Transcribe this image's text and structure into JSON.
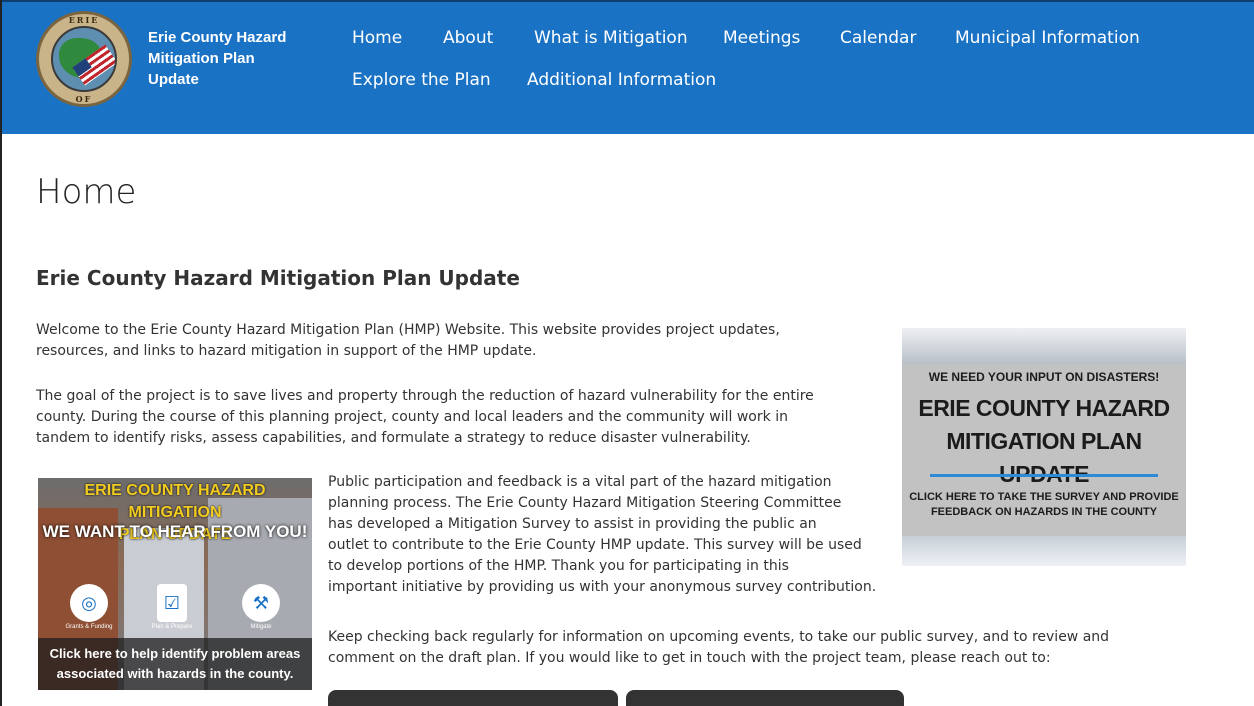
{
  "header": {
    "site_title": "Erie County Hazard Mitigation Plan Update",
    "seal_text_top": "ERIE",
    "seal_text_bottom": "OF",
    "background_color": "#1a72c4"
  },
  "nav": {
    "items": [
      {
        "label": "Home"
      },
      {
        "label": "About"
      },
      {
        "label": "What is Mitigation"
      },
      {
        "label": "Meetings"
      },
      {
        "label": "Calendar"
      },
      {
        "label": "Municipal Information"
      },
      {
        "label": "Explore the Plan"
      },
      {
        "label": "Additional Information"
      }
    ]
  },
  "main": {
    "page_title": "Home",
    "subtitle": "Erie County Hazard Mitigation Plan Update",
    "para1_line1": "Welcome to the Erie County Hazard Mitigation Plan (HMP) Website. This website provides project updates,",
    "para1_line2": "resources, and links to hazard mitigation in support of the HMP update.",
    "para2_line1": "The goal of the project is to save lives and property through the reduction of hazard vulnerability for the entire",
    "para2_line2": "county. During the course of this planning project, county and local leaders and the community will work in",
    "para2_line3": "tandem to identify risks, assess capabilities, and formulate a strategy to reduce disaster vulnerability.",
    "para3_lines": [
      "Public participation and feedback is a vital part of the hazard mitigation",
      "planning process. The Erie County Hazard Mitigation Steering Committee",
      "has developed a Mitigation Survey to assist in providing the public an",
      "outlet to contribute to the Erie County HMP update. This survey will be used",
      "to develop portions of the HMP. Thank you for participating in this",
      "important initiative by providing us with your anonymous survey contribution."
    ],
    "para4_line1": "Keep checking back regularly for information on upcoming events, to take our public survey, and to review and",
    "para4_line2": "comment on the draft plan. If you would like to get in touch with the project team, please reach out to:"
  },
  "promo_left": {
    "title_line1": "ERIE COUNTY HAZARD MITIGATION",
    "title_line2": "PLAN UPDATE",
    "headline": "WE WANT TO HEAR FROM YOU!",
    "icon1_label": "Grants & Funding",
    "icon2_label": "Plan & Prepare",
    "icon3_label": "Mitigate",
    "bottom_line1": "Click here to help identify problem areas",
    "bottom_line2": "associated with hazards in the county."
  },
  "promo_right": {
    "line1": "WE NEED YOUR INPUT ON DISASTERS!",
    "line2": "ERIE COUNTY HAZARD",
    "line3": "MITIGATION PLAN UPDATE",
    "line4": "CLICK HERE TO TAKE THE SURVEY AND PROVIDE",
    "line5": "FEEDBACK ON HAZARDS IN THE COUNTY"
  }
}
